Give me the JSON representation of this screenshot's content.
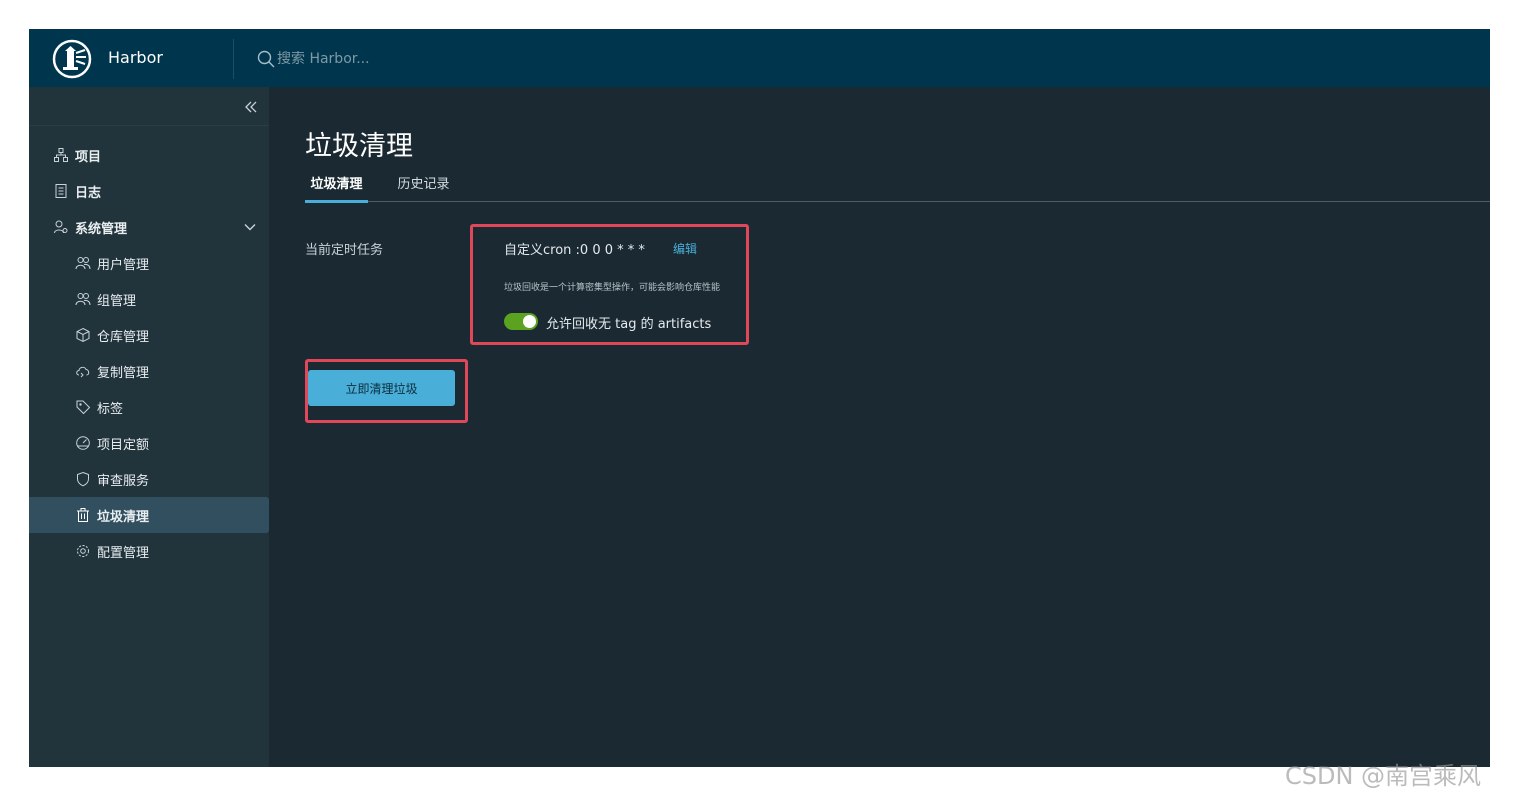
{
  "header": {
    "brand": "Harbor",
    "search_placeholder": "搜索 Harbor..."
  },
  "sidebar": {
    "items": [
      {
        "label": "项目",
        "icon": "projects-icon",
        "level": "top"
      },
      {
        "label": "日志",
        "icon": "logs-icon",
        "level": "top"
      },
      {
        "label": "系统管理",
        "icon": "admin-icon",
        "level": "top",
        "expanded": true
      }
    ],
    "sub_items": [
      {
        "label": "用户管理",
        "icon": "users-icon"
      },
      {
        "label": "组管理",
        "icon": "groups-icon"
      },
      {
        "label": "仓库管理",
        "icon": "registry-icon"
      },
      {
        "label": "复制管理",
        "icon": "replication-icon"
      },
      {
        "label": "标签",
        "icon": "tag-icon"
      },
      {
        "label": "项目定额",
        "icon": "quota-icon"
      },
      {
        "label": "审查服务",
        "icon": "shield-icon"
      },
      {
        "label": "垃圾清理",
        "icon": "trash-icon",
        "active": true
      },
      {
        "label": "配置管理",
        "icon": "gear-icon"
      }
    ]
  },
  "main": {
    "title": "垃圾清理",
    "tabs": [
      {
        "label": "垃圾清理",
        "active": true
      },
      {
        "label": "历史记录",
        "active": false
      }
    ],
    "schedule_label": "当前定时任务",
    "cron_text": "自定义cron :0 0 0 * * *",
    "edit_label": "编辑",
    "hint": "垃圾回收是一个计算密集型操作，可能会影响仓库性能",
    "toggle_label": "允许回收无 tag 的 artifacts",
    "toggle_on": true,
    "gc_button": "立即清理垃圾"
  },
  "watermark": "CSDN @南宫乘风",
  "colors": {
    "header_bg": "#00364d",
    "sidebar_bg": "#21333b",
    "main_bg": "#1b2a32",
    "accent": "#49afd9",
    "toggle_on": "#5aa220",
    "highlight": "#e0485a"
  }
}
